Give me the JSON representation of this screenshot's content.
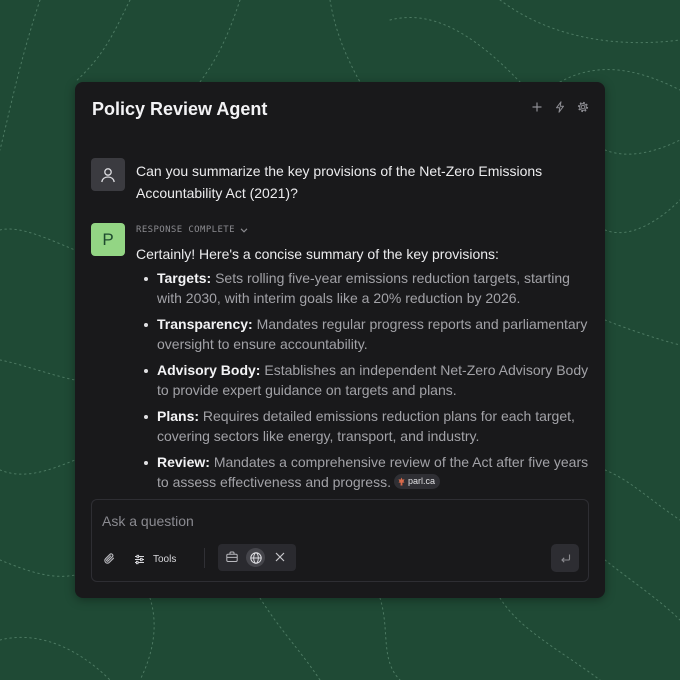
{
  "app": {
    "title": "Policy Review Agent",
    "header_icons": [
      "plus-icon",
      "lightning-icon",
      "gear-icon"
    ]
  },
  "colors": {
    "background": "#1f4a35",
    "panel": "#19191b",
    "agent_avatar": "#93d584"
  },
  "messages": {
    "user": {
      "avatar_icon": "user-icon",
      "text": "Can you summarize the key provisions of the Net-Zero Emissions Accountability Act (2021)?"
    },
    "agent": {
      "avatar_letter": "P",
      "status": "RESPONSE COMPLETE",
      "intro": "Certainly! Here's a concise summary of the key provisions:",
      "bullets": [
        {
          "label": "Targets:",
          "text": "Sets rolling five-year emissions reduction targets, starting with 2030, with interim goals like a 20% reduction by 2026."
        },
        {
          "label": "Transparency:",
          "text": "Mandates regular progress reports and parliamentary oversight to ensure accountability."
        },
        {
          "label": "Advisory Body:",
          "text": "Establishes an independent Net-Zero Advisory Body to provide expert guidance on targets and plans."
        },
        {
          "label": "Plans:",
          "text": "Requires detailed emissions reduction plans for each target, covering sectors like energy, transport, and industry."
        },
        {
          "label": "Review:",
          "text": "Mandates a comprehensive review of the Act after five years to assess effectiveness and progress."
        }
      ],
      "citation": "parl.ca"
    }
  },
  "composer": {
    "placeholder": "Ask a question",
    "tools_label": "Tools",
    "icons": [
      "paperclip-icon",
      "sliders-icon",
      "briefcase-icon",
      "globe-icon",
      "close-icon",
      "enter-icon"
    ]
  }
}
